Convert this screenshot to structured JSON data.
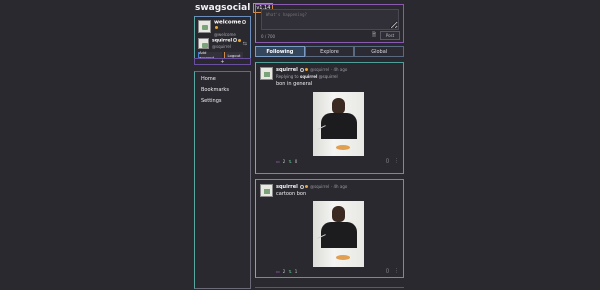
{
  "brand": {
    "name": "swagsocial",
    "version": "v1.14"
  },
  "accounts": [
    {
      "name": "welcome",
      "handle": "@welcome"
    },
    {
      "name": "squirrel",
      "handle": "@squirrel"
    }
  ],
  "account_actions": {
    "add_label": "Add account",
    "logout_label": "Logout",
    "expand_label": "+",
    "switch_label": "⇆"
  },
  "nav": {
    "items": [
      "Home",
      "Bookmarks",
      "Settings"
    ]
  },
  "compose": {
    "placeholder": "What's happening?",
    "count": "0 / 700",
    "post_label": "Post"
  },
  "tabs": [
    "Following",
    "Explore",
    "Global"
  ],
  "posts": [
    {
      "user": "squirrel",
      "handle": "@squirrel",
      "time": "4h ago",
      "reply_prefix": "Replying to",
      "reply_user": "squirrel",
      "reply_handle": "@squirrel",
      "text": "bon in general",
      "replies": "2",
      "boosts": "0"
    },
    {
      "user": "squirrel",
      "handle": "@squirrel",
      "time": "4h ago",
      "text": "cartoon bon",
      "replies": "2",
      "boosts": "1"
    }
  ],
  "colors": {
    "accent_teal": "#5fb8b0",
    "accent_purple": "#b070c8",
    "accent_orange": "#d08a4a",
    "tab_active": "#34465c"
  }
}
